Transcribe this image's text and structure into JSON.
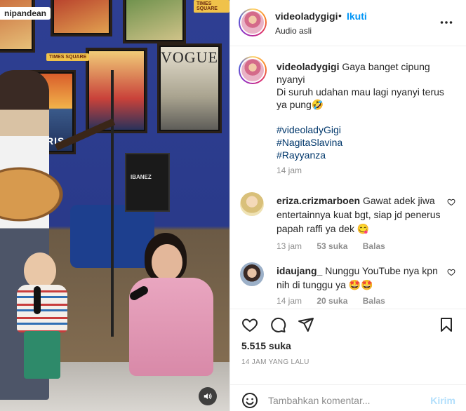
{
  "media": {
    "overlay_username": "nipandean",
    "poster_vogue": "VOGUE",
    "poster_paris": "PARIS",
    "sign_text": "TIMES SQUARE",
    "amp_label": "IBANEZ",
    "volume_icon": "speaker-icon"
  },
  "header": {
    "username": "videoladygigi",
    "separator": "•",
    "follow_label": "Ikuti",
    "audio_label": "Audio asli",
    "more_icon": "more-options-icon"
  },
  "caption": {
    "username": "videoladygigi",
    "text": "Gaya banget cipung nyanyi",
    "line2": "Di suruh udahan mau lagi nyanyi terus ya pung🤣",
    "hashtags": [
      "#videoladyGigi",
      "#NagitaSlavina",
      "#Rayyanza"
    ],
    "time": "14 jam"
  },
  "comments": [
    {
      "username": "eriza.crizmarboen",
      "text": "Gawat adek jiwa entertainnya kuat bgt, siap jd penerus papah raffi ya dek 😋",
      "time": "13 jam",
      "likes": "53 suka",
      "reply_label": "Balas"
    },
    {
      "username": "idaujang_",
      "text": "Nunggu YouTube nya kpn nih di tunggu ya 🤩🤩",
      "time": "14 jam",
      "likes": "20 suka",
      "reply_label": "Balas"
    }
  ],
  "actions": {
    "like_icon": "heart-icon",
    "comment_icon": "comment-icon",
    "share_icon": "share-icon",
    "save_icon": "bookmark-icon",
    "likes_count": "5.515 suka",
    "posted_time": "14 JAM YANG LALU"
  },
  "add_comment": {
    "emoji_icon": "emoji-icon",
    "placeholder": "Tambahkan komentar...",
    "post_label": "Kirim"
  }
}
